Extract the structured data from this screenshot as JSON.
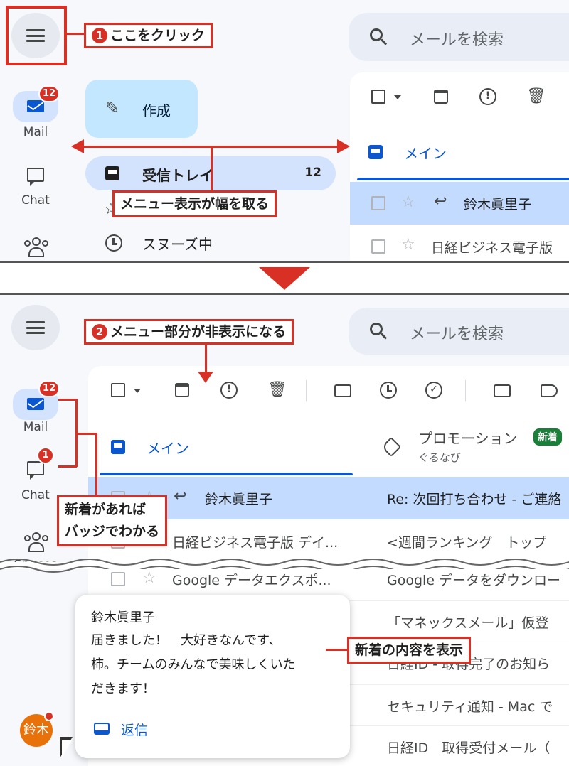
{
  "colors": {
    "accent": "#0b57d0",
    "annotation": "#d93025",
    "selected_row": "#c2dbff",
    "new_chip": "#188038",
    "avatar": "#e8710a"
  },
  "top": {
    "rail": {
      "mail_label": "Mail",
      "mail_badge": "12",
      "chat_label": "Chat"
    },
    "search": {
      "placeholder": "メールを検索"
    },
    "compose_label": "作成",
    "nav": [
      {
        "label": "受信トレイ",
        "count": "12",
        "icon": "inbox-icon"
      },
      {
        "label": "スヌーズ中",
        "icon": "clock-icon"
      }
    ],
    "tab_main": "メイン",
    "rows": [
      {
        "sender": "鈴木眞里子"
      },
      {
        "sender": "日経ビジネス電子版"
      }
    ],
    "callout_1": {
      "num": "1",
      "text": "ここをクリック"
    },
    "callout_width": "メニュー表示が幅を取る"
  },
  "bottom": {
    "rail": {
      "mail_label": "Mail",
      "mail_badge": "12",
      "chat_label": "Chat",
      "chat_badge": "1",
      "spaces_label": "Spaces"
    },
    "search": {
      "placeholder": "メールを検索"
    },
    "tabs": {
      "main": "メイン",
      "promo": "プロモーション",
      "promo_sub": "ぐるなび",
      "new_chip": "新着"
    },
    "rows": [
      {
        "sender": "鈴木眞里子",
        "subject": "Re: 次回打ち合わせ - ご連絡"
      },
      {
        "sender": "日経ビジネス電子版 デイ...",
        "subject": "<週間ランキング　トップ"
      },
      {
        "sender": "Google データエクスポ...",
        "subject": "Google データをダウンロー"
      },
      {
        "subject": "「マネックスメール」仮登"
      },
      {
        "subject": "日経ID - 取得完了のお知ら"
      },
      {
        "subject": "セキュリティ通知 - Mac で"
      },
      {
        "subject": "日経ID　取得受付メール（"
      }
    ],
    "popup": {
      "sender": "鈴木眞里子",
      "lines": [
        "届きました！　大好きなんです、",
        "柿。チームのみんなで美味しくいた",
        "だきます！"
      ],
      "reply_label": "返信"
    },
    "avatar_text": "鈴木",
    "callout_2": {
      "num": "2",
      "text": "メニュー部分が非表示になる"
    },
    "callout_badge": [
      "新着があれば",
      "バッジでわかる"
    ],
    "callout_content": "新着の内容を表示"
  }
}
